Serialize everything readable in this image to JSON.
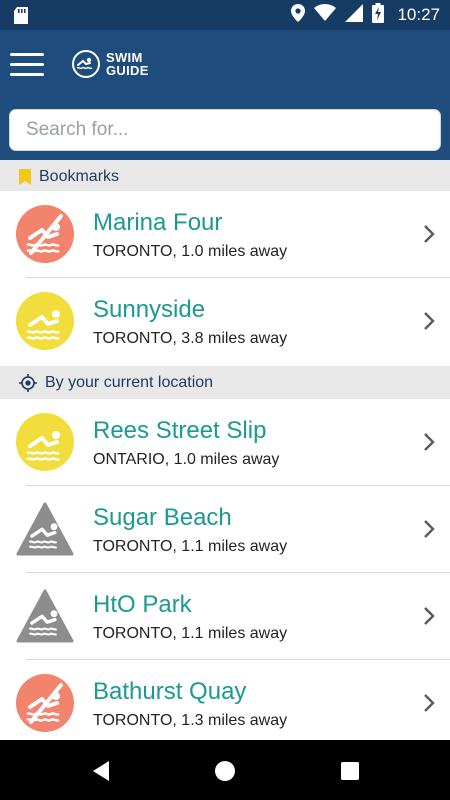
{
  "status_bar": {
    "time": "10:27",
    "icons": [
      "sd-card-icon",
      "location-icon",
      "wifi-icon",
      "signal-icon",
      "battery-charging-icon"
    ]
  },
  "app_bar": {
    "logo_line1": "SWIM",
    "logo_line2": "GUIDE"
  },
  "search": {
    "placeholder": "Search for..."
  },
  "sections": {
    "bookmarks": {
      "label": "Bookmarks",
      "icon": "bookmark-icon"
    },
    "nearby": {
      "label": "By your current location",
      "icon": "my-location-icon"
    }
  },
  "beaches": [
    {
      "name": "Marina Four",
      "location": "TORONTO, 1.0 miles away",
      "status": "no-swim",
      "color": "#f2846e"
    },
    {
      "name": "Sunnyside",
      "location": "TORONTO, 3.8 miles away",
      "status": "swim",
      "color": "#f1de3c"
    },
    {
      "name": "Rees Street Slip",
      "location": "ONTARIO, 1.0 miles away",
      "status": "swim",
      "color": "#f1de3c"
    },
    {
      "name": "Sugar Beach",
      "location": "TORONTO, 1.1 miles away",
      "status": "unknown",
      "color": "#8d8d8d"
    },
    {
      "name": "HtO Park",
      "location": "TORONTO, 1.1 miles away",
      "status": "unknown",
      "color": "#8d8d8d"
    },
    {
      "name": "Bathurst Quay",
      "location": "TORONTO, 1.3 miles away",
      "status": "no-swim",
      "color": "#f2846e"
    }
  ],
  "colors": {
    "primary": "#1e4c7c",
    "status_bar": "#163c65",
    "accent_text": "#1a9a91",
    "bookmark": "#f5c518"
  }
}
